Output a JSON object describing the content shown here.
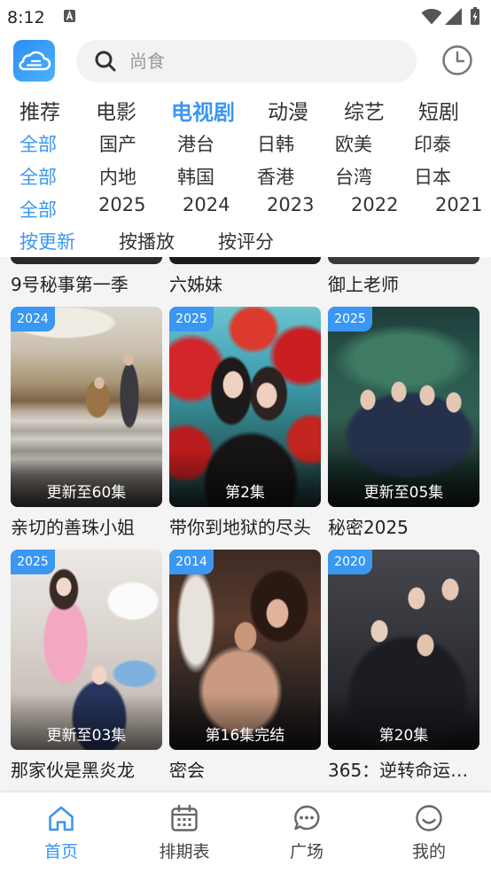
{
  "colors": {
    "accent": "#3a97f2",
    "text": "#222222",
    "content_background": "#f4f4f4"
  },
  "status_bar": {
    "time": "8:12",
    "icons": [
      "notification-a-icon",
      "wifi-icon",
      "signal-icon",
      "battery-charging-icon"
    ]
  },
  "header": {
    "logo_icon": "cloud-logo-icon",
    "search_icon": "search-icon",
    "search_placeholder": "尚食",
    "history_icon": "clock-icon"
  },
  "categories": [
    {
      "label": "推荐",
      "active": false
    },
    {
      "label": "电影",
      "active": false
    },
    {
      "label": "电视剧",
      "active": true
    },
    {
      "label": "动漫",
      "active": false
    },
    {
      "label": "综艺",
      "active": false
    },
    {
      "label": "短剧",
      "active": false
    }
  ],
  "filters": {
    "region": [
      {
        "label": "全部",
        "active": true
      },
      {
        "label": "国产",
        "active": false
      },
      {
        "label": "港台",
        "active": false
      },
      {
        "label": "日韩",
        "active": false
      },
      {
        "label": "欧美",
        "active": false
      },
      {
        "label": "印泰",
        "active": false
      }
    ],
    "area": [
      {
        "label": "全部",
        "active": true
      },
      {
        "label": "内地",
        "active": false
      },
      {
        "label": "韩国",
        "active": false
      },
      {
        "label": "香港",
        "active": false
      },
      {
        "label": "台湾",
        "active": false
      },
      {
        "label": "日本",
        "active": false
      }
    ],
    "year": [
      {
        "label": "全部",
        "active": true
      },
      {
        "label": "2025",
        "active": false
      },
      {
        "label": "2024",
        "active": false
      },
      {
        "label": "2023",
        "active": false
      },
      {
        "label": "2022",
        "active": false
      },
      {
        "label": "2021",
        "active": false
      }
    ],
    "sort": [
      {
        "label": "按更新",
        "active": true
      },
      {
        "label": "按播放",
        "active": false
      },
      {
        "label": "按评分",
        "active": false
      }
    ]
  },
  "grid": {
    "partial_row": [
      {
        "title": "9号秘事第一季"
      },
      {
        "title": "六姊妹"
      },
      {
        "title": "御上老师"
      }
    ],
    "items": [
      {
        "title": "亲切的善珠小姐",
        "year": "2024",
        "episodes": "更新至60集"
      },
      {
        "title": "带你到地狱的尽头",
        "year": "2025",
        "episodes": "第2集"
      },
      {
        "title": "秘密2025",
        "year": "2025",
        "episodes": "更新至05集"
      },
      {
        "title": "那家伙是黑炎龙",
        "year": "2025",
        "episodes": "更新至03集"
      },
      {
        "title": "密会",
        "year": "2014",
        "episodes": "第16集完结"
      },
      {
        "title": "365：逆转命运…",
        "year": "2020",
        "episodes": "第20集"
      }
    ]
  },
  "bottom_nav": [
    {
      "label": "首页",
      "icon": "home-icon",
      "active": true
    },
    {
      "label": "排期表",
      "icon": "calendar-icon",
      "active": false
    },
    {
      "label": "广场",
      "icon": "chat-bubble-icon",
      "active": false
    },
    {
      "label": "我的",
      "icon": "smiley-icon",
      "active": false
    }
  ]
}
